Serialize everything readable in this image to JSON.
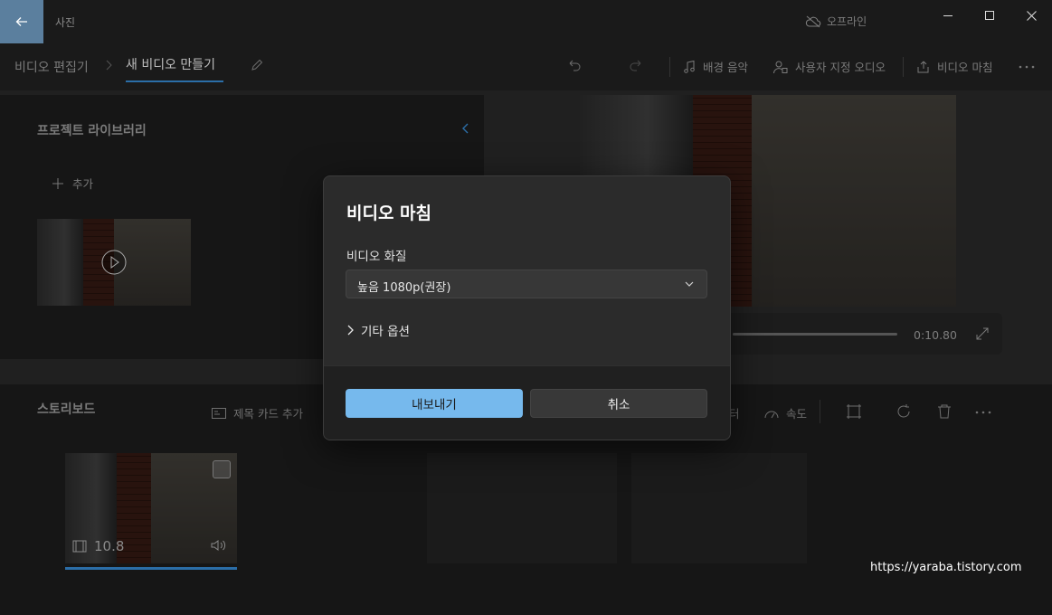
{
  "app": {
    "title": "사진",
    "offline_label": "오프라인"
  },
  "breadcrumb": {
    "root": "비디오 편집기",
    "current": "새 비디오 만들기"
  },
  "toolbar": {
    "background_music": "배경 음악",
    "custom_audio": "사용자 지정 오디오",
    "finish_video": "비디오 마침"
  },
  "library": {
    "title": "프로젝트 라이브러리",
    "add_label": "추가"
  },
  "preview": {
    "time": "0:10.80"
  },
  "storyboard": {
    "title": "스토리보드",
    "add_title_card": "제목 카드 추가",
    "filters_fragment": "터",
    "speed": "속도",
    "clip_duration": "10.8"
  },
  "dialog": {
    "title": "비디오 마침",
    "quality_label": "비디오 화질",
    "quality_value": "높음 1080p(권장)",
    "more_options": "기타 옵션",
    "export_button": "내보내기",
    "cancel_button": "취소"
  },
  "watermark": "https://yaraba.tistory.com",
  "colors": {
    "accent": "#76b9ed",
    "back_button": "#5b7f9e",
    "progress": "#2b6ea8"
  }
}
